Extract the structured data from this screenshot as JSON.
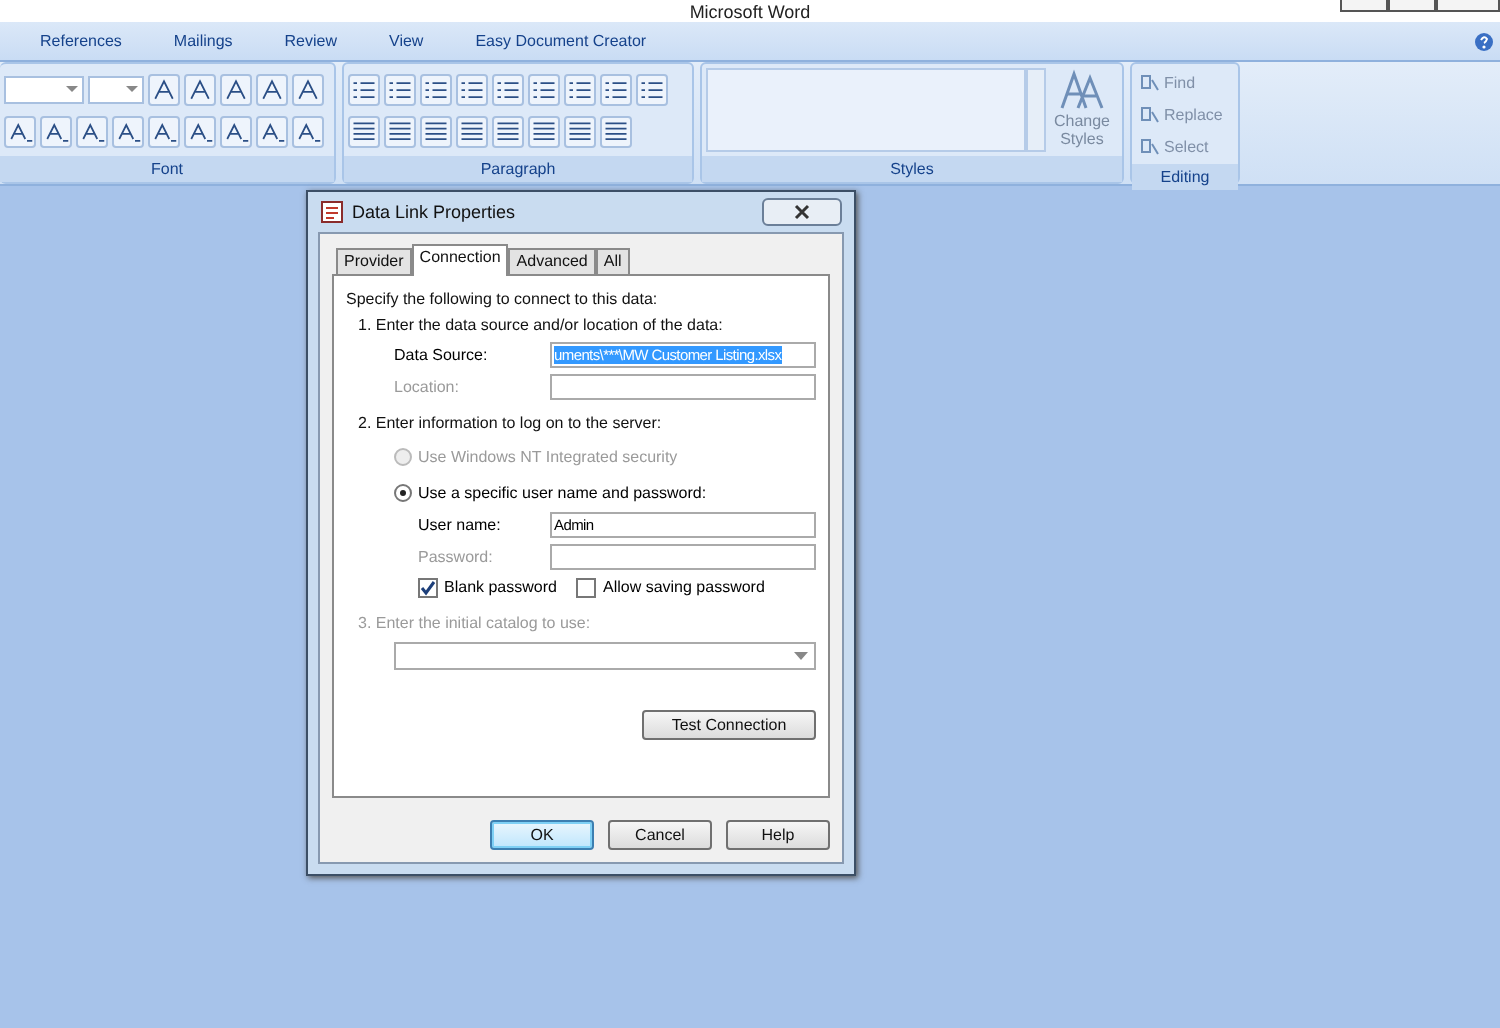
{
  "window": {
    "title": "Microsoft Word"
  },
  "ribbon_tabs": [
    {
      "label": "References"
    },
    {
      "label": "Mailings"
    },
    {
      "label": "Review"
    },
    {
      "label": "View"
    },
    {
      "label": "Easy Document Creator"
    }
  ],
  "ribbon_groups": [
    {
      "kind": "font",
      "label": "Font"
    },
    {
      "kind": "paragraph",
      "label": "Paragraph"
    },
    {
      "kind": "styles",
      "label": "Styles",
      "button": "Change Styles"
    },
    {
      "kind": "editing",
      "label": "Editing",
      "items": [
        "Find",
        "Replace",
        "Select"
      ]
    }
  ],
  "dialog": {
    "title": "Data Link Properties",
    "tabs": [
      {
        "label": "Provider",
        "selected": false
      },
      {
        "label": "Connection",
        "selected": true
      },
      {
        "label": "Advanced",
        "selected": false
      },
      {
        "label": "All",
        "selected": false
      }
    ],
    "instruction": "Specify the following to connect to this data:",
    "step_1": {
      "label": "1. Enter the data source and/or location of the data:",
      "fields": [
        {
          "label": "Data Source:",
          "value": "uments\\***\\MW Customer Listing.xlsx",
          "disabled": false,
          "highlighted": true
        },
        {
          "label": "Location:",
          "disabled": true
        }
      ]
    },
    "step_2": {
      "label": "2. Enter information to log on to the server:",
      "options": [
        {
          "label": "Use Windows NT Integrated security",
          "selected": false,
          "disabled": true
        },
        {
          "label": "Use a specific user name and password:",
          "selected": true,
          "disabled": false
        }
      ],
      "fields": [
        {
          "label": "User name:",
          "value": "Admin",
          "disabled": false
        },
        {
          "label": "Password:",
          "disabled": true
        }
      ],
      "checkboxes": [
        {
          "label": "Blank password",
          "checked": true
        },
        {
          "label": "Allow saving password",
          "checked": false
        }
      ]
    },
    "step_3": {
      "label": "3. Enter the initial catalog to use:",
      "disabled": true
    },
    "test_button": "Test Connection",
    "buttons": [
      {
        "label": "OK",
        "default": true
      },
      {
        "label": "Cancel",
        "default": false
      },
      {
        "label": "Help",
        "default": false
      }
    ]
  }
}
